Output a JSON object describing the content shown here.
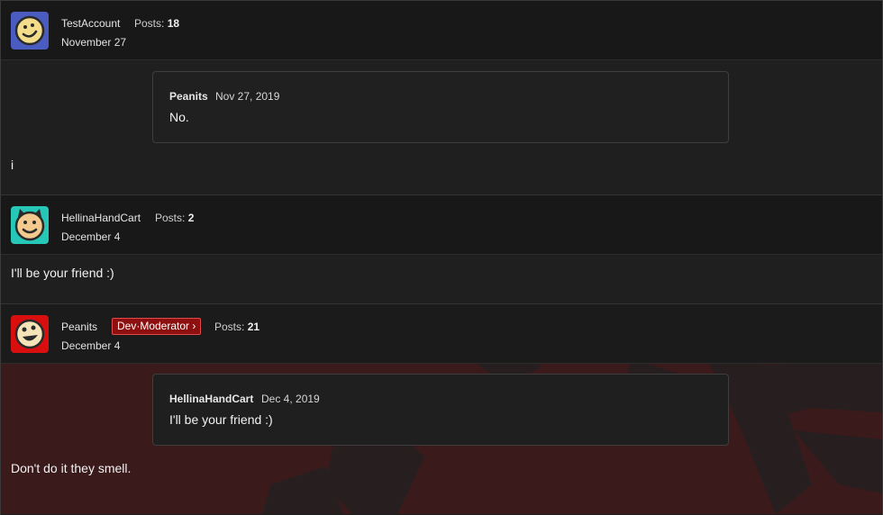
{
  "posts": [
    {
      "author": "TestAccount",
      "posts_label": "Posts:",
      "posts_count": "18",
      "date": "November 27",
      "quote": {
        "author": "Peanits",
        "date": "Nov 27, 2019",
        "body": "No."
      },
      "body": "i"
    },
    {
      "author": "HellinaHandCart",
      "posts_label": "Posts:",
      "posts_count": "2",
      "date": "December 4",
      "body": "I'll be your friend :)"
    },
    {
      "author": "Peanits",
      "badge": "Dev·Moderator ›",
      "posts_label": "Posts:",
      "posts_count": "21",
      "date": "December 4",
      "quote": {
        "author": "HellinaHandCart",
        "date": "Dec 4, 2019",
        "body": "I'll be your friend :)"
      },
      "body": "Don't do it they smell."
    }
  ],
  "colors": {
    "page_bg": "#1f1f1f",
    "header_bg": "#181818",
    "moderator_bg": "#3a1a1a",
    "badge_red": "#8e0f0f",
    "avatar1_bg": "#4a5cc0",
    "avatar2_bg": "#26c7b7",
    "avatar3_bg": "#d90f0f"
  },
  "icons": [
    "smiley-avatar-icon",
    "cat-avatar-icon",
    "grin-avatar-icon"
  ]
}
